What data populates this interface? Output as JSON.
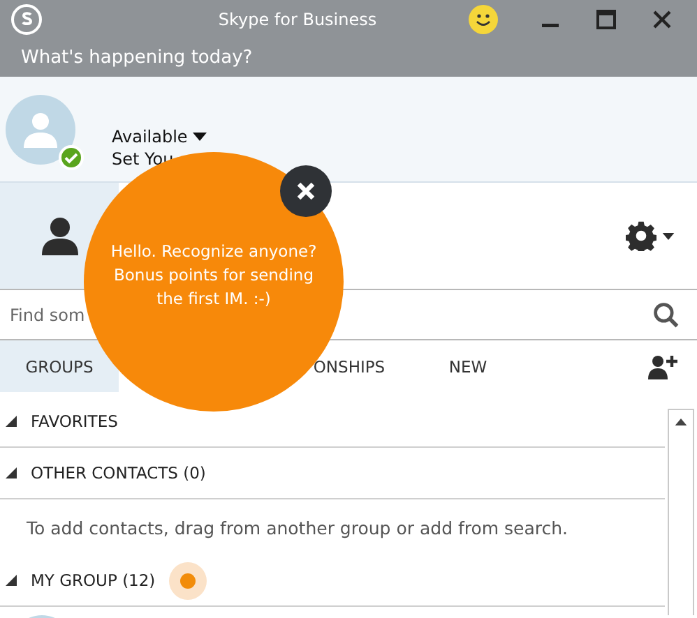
{
  "window": {
    "title": "Skype for Business"
  },
  "status_prompt": "What's happening today?",
  "profile": {
    "presence": "Available",
    "location": "Set You",
    "available": true
  },
  "search": {
    "placeholder": "Find som"
  },
  "tabs": [
    {
      "label": "GROUPS",
      "selected": true
    },
    {
      "label": "ONSHIPS",
      "selected": false
    },
    {
      "label": "NEW",
      "selected": false
    }
  ],
  "groups": [
    {
      "name": "FAVORITES",
      "expanded": true
    },
    {
      "name": "OTHER CONTACTS (0)",
      "expanded": true,
      "hint": "To add contacts, drag from another group or add from search."
    },
    {
      "name": "MY GROUP (12)",
      "expanded": true,
      "new_activity": true
    }
  ],
  "tooltip": {
    "message": "Hello. Recognize anyone? Bonus points for sending the first IM. :-)"
  }
}
